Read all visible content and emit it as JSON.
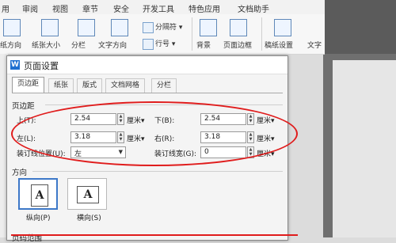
{
  "menubar": {
    "items": [
      "用",
      "审阅",
      "视图",
      "章节",
      "安全",
      "开发工具",
      "特色应用",
      "文档助手"
    ]
  },
  "ribbon": {
    "items": [
      "纸方向",
      "纸张大小",
      "分栏",
      "文字方向",
      "分隔符",
      "行号",
      "背景",
      "页面边框",
      "稿纸设置",
      "文字"
    ]
  },
  "dialog": {
    "title": "页面设置",
    "app_icon": "W",
    "close_icon": "close-icon",
    "tabs": [
      "页边距",
      "纸张",
      "版式",
      "文档网格",
      "分栏"
    ],
    "active_tab": "页边距",
    "margins_section": "页边距",
    "fields": {
      "top": {
        "label": "上(T):",
        "value": "2.54",
        "unit": "厘米"
      },
      "bottom": {
        "label": "下(B):",
        "value": "2.54",
        "unit": "厘米"
      },
      "left": {
        "label": "左(L):",
        "value": "3.18",
        "unit": "厘米"
      },
      "right": {
        "label": "右(R):",
        "value": "3.18",
        "unit": "厘米"
      },
      "gutter_pos": {
        "label": "装订线位置(U):",
        "value": "左"
      },
      "gutter_width": {
        "label": "装订线宽(G):",
        "value": "0",
        "unit": "厘米"
      }
    },
    "orientation_section": "方向",
    "portrait_label": "纵向(P)",
    "landscape_label": "横向(S)",
    "page_section_partial": "页码范围"
  },
  "colors": {
    "annotation": "#e01c1c",
    "accent": "#3d78c8"
  }
}
